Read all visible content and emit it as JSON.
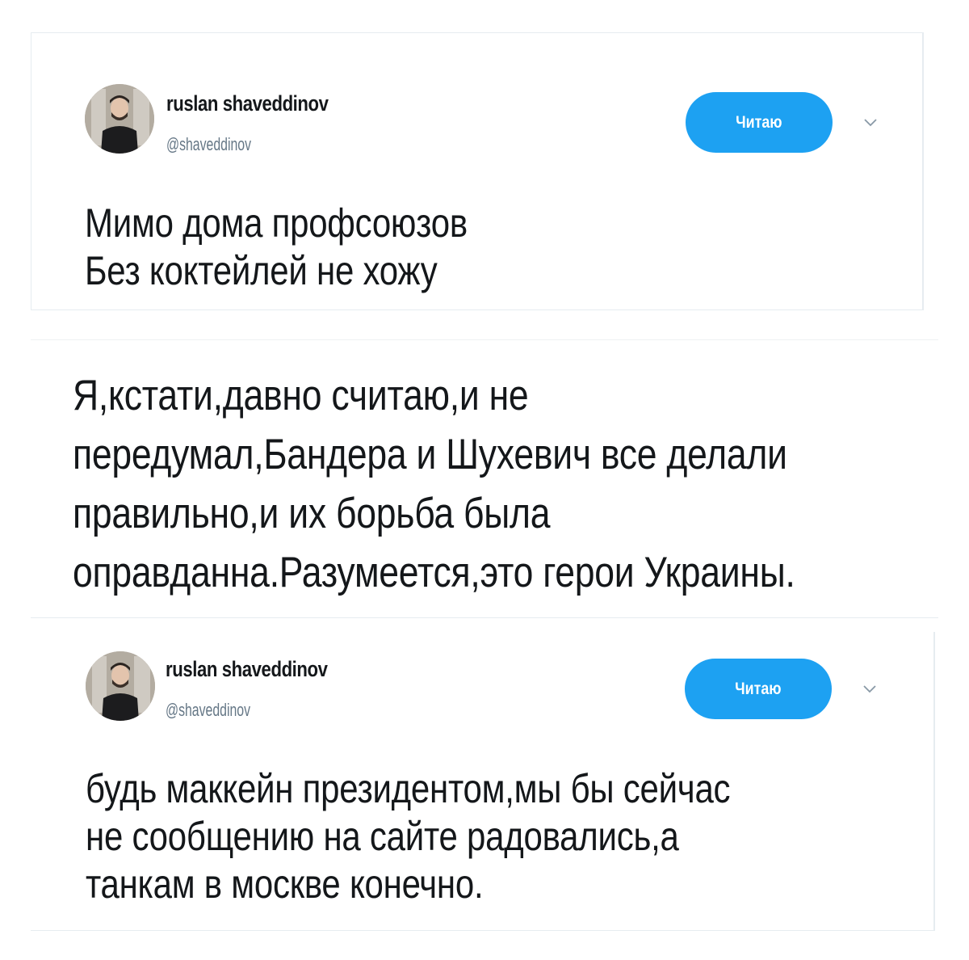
{
  "colors": {
    "follow_button_bg": "#1da1f2",
    "follow_button_text": "#ffffff",
    "handle_gray": "#657786",
    "text_dark": "#14171a",
    "border": "#e6ecf0"
  },
  "tweets": [
    {
      "author": {
        "name": "ruslan shaveddinov",
        "handle": "@shaveddinov",
        "avatar_icon": "user-avatar"
      },
      "follow_label": "Читаю",
      "caret_icon": "chevron-down-icon",
      "lines": [
        "Мимо дома профсоюзов",
        "Без коктейлей не хожу"
      ]
    },
    {
      "lines": [
        "Я,кстати,давно считаю,и не",
        "передумал,Бандера и Шухевич все делали",
        "правильно,и их борьба была",
        "оправданна.Разумеется,это герои Украины."
      ]
    },
    {
      "author": {
        "name": "ruslan shaveddinov",
        "handle": "@shaveddinov",
        "avatar_icon": "user-avatar"
      },
      "follow_label": "Читаю",
      "caret_icon": "chevron-down-icon",
      "lines": [
        "будь маккейн президентом,мы бы сейчас",
        "не сообщению на сайте радовались,а",
        "танкам в москве конечно."
      ]
    }
  ]
}
